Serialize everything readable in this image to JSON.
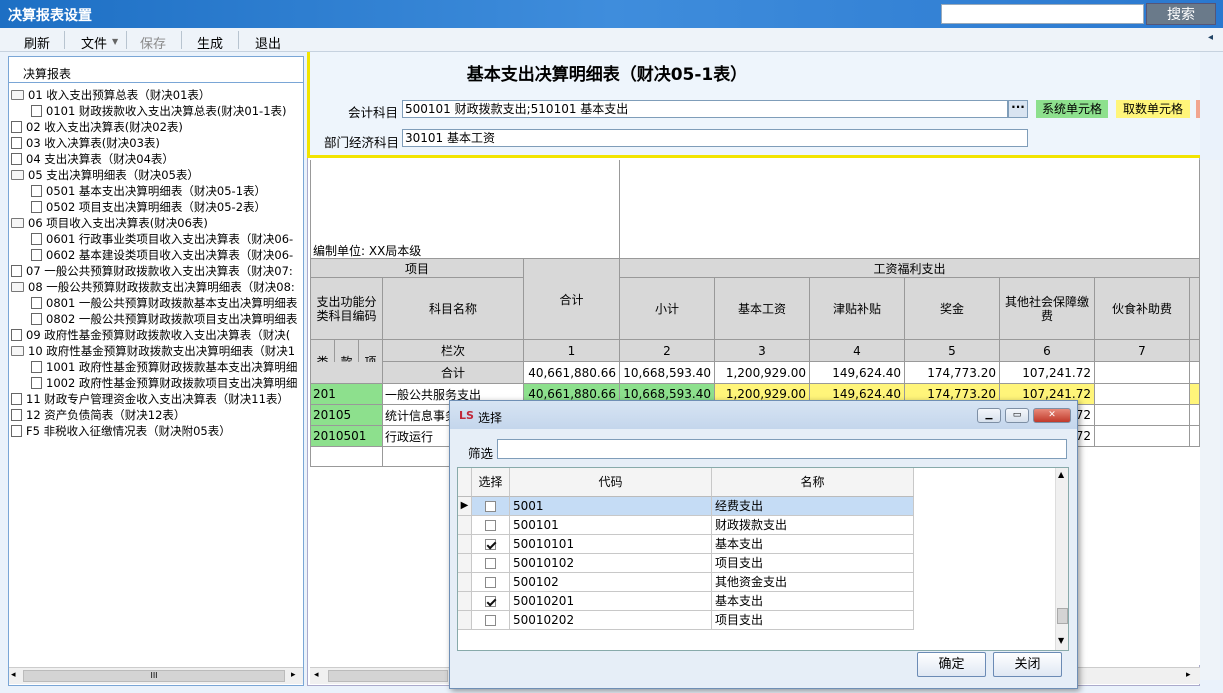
{
  "window": {
    "title": "决算报表设置",
    "search_button": "搜索",
    "search_value": ""
  },
  "toolbar": {
    "items": [
      "刷新",
      "文件",
      "保存",
      "生成",
      "退出"
    ]
  },
  "left": {
    "header": "决算报表",
    "tree": [
      {
        "text": "01  收入支出预算总表（财决01表）",
        "level": 0,
        "folder": true
      },
      {
        "text": "0101  财政拨款收入支出决算总表(财决01-1表)",
        "level": 1,
        "folder": false
      },
      {
        "text": "02  收入支出决算表(财决02表)",
        "level": 0,
        "folder": false
      },
      {
        "text": "03  收入决算表(财决03表)",
        "level": 0,
        "folder": false
      },
      {
        "text": "04  支出决算表（财决04表）",
        "level": 0,
        "folder": false
      },
      {
        "text": "05  支出决算明细表（财决05表）",
        "level": 0,
        "folder": true
      },
      {
        "text": "0501  基本支出决算明细表（财决05-1表）",
        "level": 1,
        "folder": false
      },
      {
        "text": "0502  项目支出决算明细表（财决05-2表）",
        "level": 1,
        "folder": false
      },
      {
        "text": "06  项目收入支出决算表(财决06表)",
        "level": 0,
        "folder": true
      },
      {
        "text": "0601  行政事业类项目收入支出决算表（财决06-",
        "level": 1,
        "folder": false
      },
      {
        "text": "0602  基本建设类项目收入支出决算表（财决06-",
        "level": 1,
        "folder": false
      },
      {
        "text": "07  一般公共预算财政拨款收入支出决算表（财决07:",
        "level": 0,
        "folder": false
      },
      {
        "text": "08  一般公共预算财政拨款支出决算明细表（财决08:",
        "level": 0,
        "folder": true
      },
      {
        "text": "0801  一般公共预算财政拨款基本支出决算明细表",
        "level": 1,
        "folder": false
      },
      {
        "text": "0802  一般公共预算财政拨款项目支出决算明细表",
        "level": 1,
        "folder": false
      },
      {
        "text": "09  政府性基金预算财政拨款收入支出决算表（财决(",
        "level": 0,
        "folder": false
      },
      {
        "text": "10  政府性基金预算财政拨款支出决算明细表（财决1",
        "level": 0,
        "folder": true
      },
      {
        "text": "1001  政府性基金预算财政拨款基本支出决算明细",
        "level": 1,
        "folder": false
      },
      {
        "text": "1002  政府性基金预算财政拨款项目支出决算明细",
        "level": 1,
        "folder": false
      },
      {
        "text": "11  财政专户管理资金收入支出决算表（财决11表）",
        "level": 0,
        "folder": false
      },
      {
        "text": "12  资产负债简表（财决12表）",
        "level": 0,
        "folder": false
      },
      {
        "text": "F5  非税收入征缴情况表（财决附05表）",
        "level": 0,
        "folder": false
      }
    ],
    "scroll_grip": "III"
  },
  "report": {
    "title": "基本支出决算明细表（财决05-1表）",
    "account_label": "会计科目",
    "account_value": "500101 财政拨款支出;510101 基本支出",
    "ellipsis": "···",
    "dept_label": "部门经济科目",
    "dept_value": "30101 基本工资",
    "legend_sys": "系统单元格",
    "legend_fetch": "取数单元格",
    "unit_label": "编制单位: XX局本级"
  },
  "grid": {
    "h_project": "项目",
    "h_total": "合计",
    "h_group": "工资福利支出",
    "h_code": "支出功能分类科目编码",
    "h_name": "科目名称",
    "h_cols": [
      "小计",
      "基本工资",
      "津贴补贴",
      "奖金",
      "其他社会保障缴费",
      "伙食补助费"
    ],
    "h_lei": "类",
    "h_kuan": "款",
    "h_xiang": "项",
    "h_lanci": "栏次",
    "col_nums": [
      "1",
      "2",
      "3",
      "4",
      "5",
      "6",
      "7"
    ],
    "sum_label": "合计",
    "sum_values": [
      "40,661,880.66",
      "10,668,593.40",
      "1,200,929.00",
      "149,624.40",
      "174,773.20",
      "107,241.72",
      ""
    ],
    "rows": [
      {
        "code": "201",
        "name": "一般公共服务支出",
        "values": [
          "40,661,880.66",
          "10,668,593.40",
          "1,200,929.00",
          "149,624.40",
          "174,773.20",
          "107,241.72",
          ""
        ]
      },
      {
        "code": "20105",
        "name": "统计信息事务",
        "values": [
          "",
          "",
          "",
          "",
          "",
          "72",
          ""
        ]
      },
      {
        "code": "2010501",
        "name": "行政运行",
        "values": [
          "",
          "",
          "",
          "",
          "",
          "72",
          ""
        ]
      }
    ]
  },
  "dialog": {
    "title": "选择",
    "logo": "LS",
    "filter_label": "筛选",
    "filter_value": "",
    "headers": [
      "选择",
      "代码",
      "名称"
    ],
    "rows": [
      {
        "code": "5001",
        "name": "经费支出",
        "checked": false,
        "selected": true
      },
      {
        "code": "500101",
        "name": "财政拨款支出",
        "checked": false,
        "selected": false
      },
      {
        "code": "50010101",
        "name": "基本支出",
        "checked": true,
        "selected": false
      },
      {
        "code": "50010102",
        "name": "项目支出",
        "checked": false,
        "selected": false
      },
      {
        "code": "500102",
        "name": "其他资金支出",
        "checked": false,
        "selected": false
      },
      {
        "code": "50010201",
        "name": "基本支出",
        "checked": true,
        "selected": false
      },
      {
        "code": "50010202",
        "name": "项目支出",
        "checked": false,
        "selected": false
      }
    ],
    "ok": "确定",
    "cancel": "关闭"
  }
}
